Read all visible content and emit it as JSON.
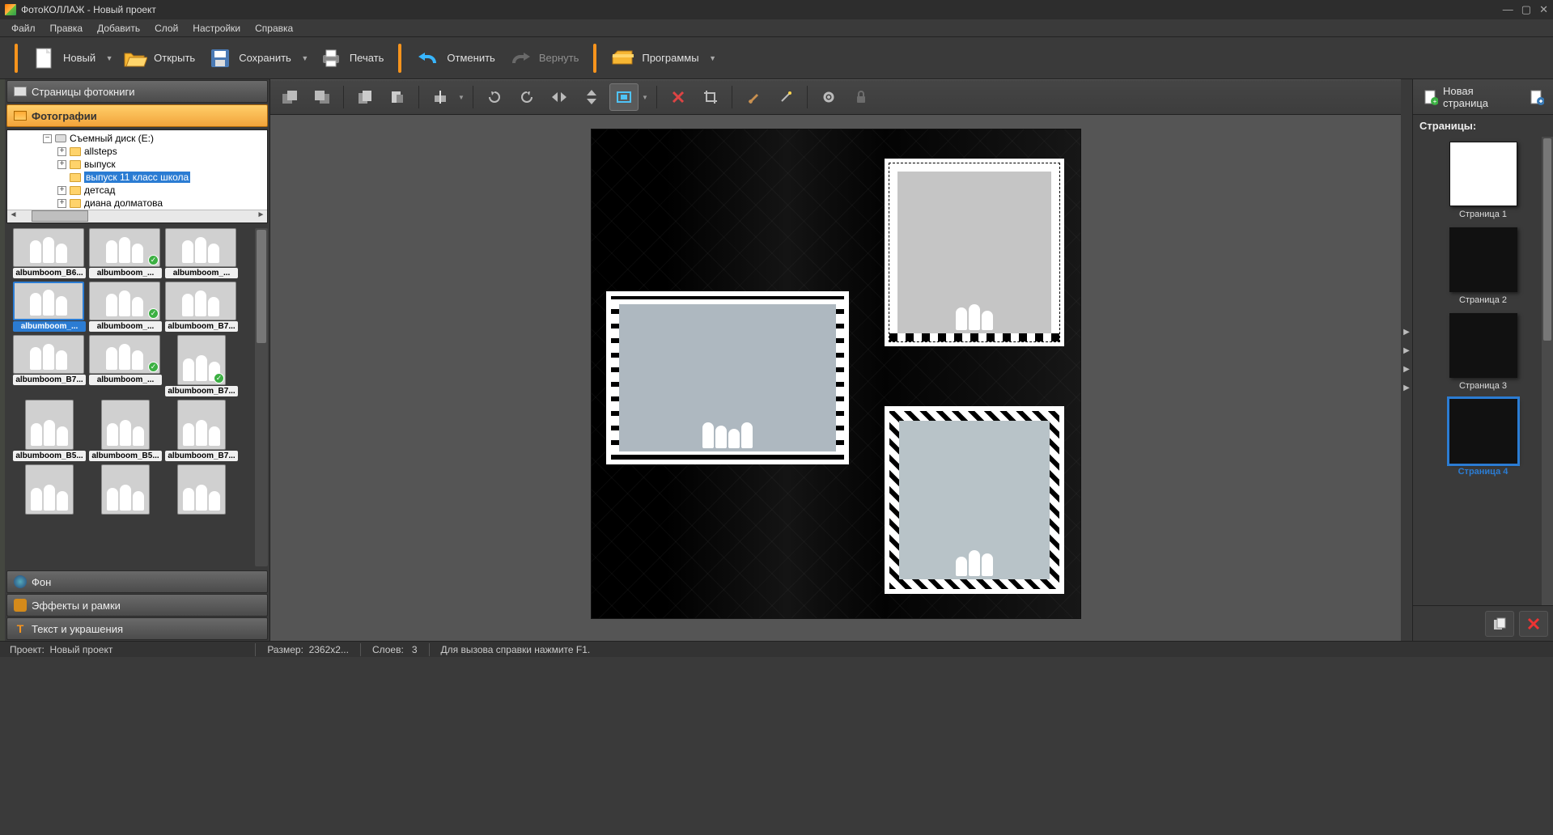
{
  "titlebar": {
    "app": "ФотоКОЛЛАЖ",
    "project": "Новый проект"
  },
  "menu": [
    "Файл",
    "Правка",
    "Добавить",
    "Слой",
    "Настройки",
    "Справка"
  ],
  "toolbar": {
    "new": "Новый",
    "open": "Открыть",
    "save": "Сохранить",
    "print": "Печать",
    "undo": "Отменить",
    "redo": "Вернуть",
    "programs": "Программы"
  },
  "leftPanel": {
    "pagesHeader": "Страницы фотокниги",
    "photosHeader": "Фотографии",
    "background": "Фон",
    "effects": "Эффекты и рамки",
    "text": "Текст и украшения",
    "tree": {
      "drive": "Съемный диск (E:)",
      "folders": [
        "allsteps",
        "выпуск",
        "выпуск 11 класс школа",
        "детсад",
        "диана долматова"
      ],
      "selectedIndex": 2
    },
    "thumbs": [
      {
        "label": "albumboom_B6...",
        "check": false
      },
      {
        "label": "albumboom_...",
        "check": true
      },
      {
        "label": "albumboom_...",
        "check": false
      },
      {
        "label": "albumboom_...",
        "check": false,
        "selected": true
      },
      {
        "label": "albumboom_...",
        "check": true
      },
      {
        "label": "albumboom_B7...",
        "check": false
      },
      {
        "label": "albumboom_B7...",
        "check": false
      },
      {
        "label": "albumboom_...",
        "check": true
      },
      {
        "label": "albumboom_B7...",
        "check": true,
        "portrait": true
      },
      {
        "label": "albumboom_B5...",
        "check": false,
        "portrait": true
      },
      {
        "label": "albumboom_B5...",
        "check": false,
        "portrait": true
      },
      {
        "label": "albumboom_B7...",
        "check": false,
        "portrait": true
      },
      {
        "label": "",
        "check": false,
        "portrait": true
      },
      {
        "label": "",
        "check": false,
        "portrait": true
      },
      {
        "label": "",
        "check": false,
        "portrait": true
      }
    ]
  },
  "rightPanel": {
    "newPage": "Новая страница",
    "title": "Страницы:",
    "pages": [
      "Страница 1",
      "Страница 2",
      "Страница 3",
      "Страница 4"
    ],
    "selectedIndex": 3
  },
  "statusbar": {
    "project_label": "Проект:",
    "project_name": "Новый проект",
    "size_label": "Размер:",
    "size_value": "2362x2...",
    "layers_label": "Слоев:",
    "layers_value": "3",
    "help": "Для вызова справки нажмите F1."
  }
}
